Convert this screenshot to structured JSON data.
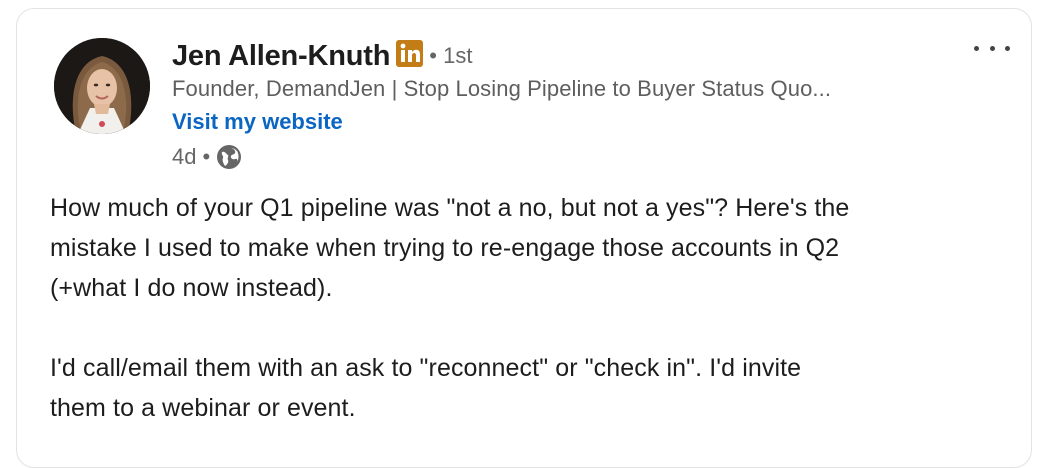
{
  "author": {
    "name": "Jen Allen-Knuth",
    "degree": "• 1st",
    "headline": "Founder, DemandJen | Stop Losing Pipeline to Buyer Status Quo...",
    "website_link": "Visit my website",
    "timestamp": "4d",
    "meta_separator": "•",
    "visibility_icon": "globe-icon",
    "badge_icon": "linkedin-icon"
  },
  "menu": {
    "more_icon": "ellipsis-icon"
  },
  "post": {
    "paragraph1_line1": "How much of your Q1 pipeline was \"not a no, but not a yes\"? Here's the",
    "paragraph1_line2": "mistake I used to make when trying to re-engage those accounts in Q2",
    "paragraph1_line3": "(+what I do now instead).",
    "paragraph2_line1": "I'd call/email them with an ask to \"reconnect\" or \"check in\". I'd invite",
    "paragraph2_line2": "them to a webinar or event."
  },
  "colors": {
    "link_blue": "#0a66c2",
    "linkedin_badge": "#c37d16",
    "text_primary": "#1d1d1d",
    "text_secondary": "#666666"
  }
}
